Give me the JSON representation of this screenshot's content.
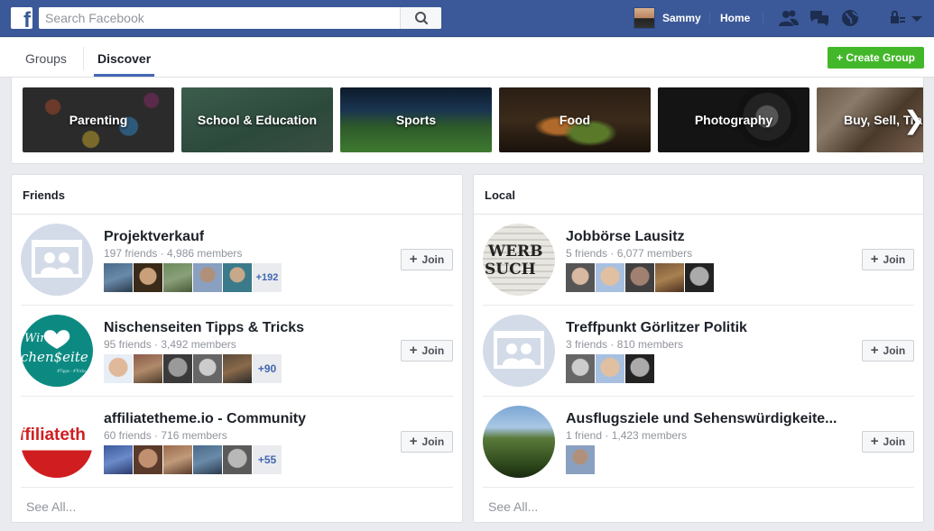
{
  "header": {
    "logo": "f",
    "search_placeholder": "Search Facebook",
    "user_name": "Sammy",
    "home_label": "Home",
    "accent": "#3b5998"
  },
  "tabs": [
    {
      "label": "Groups",
      "active": false
    },
    {
      "label": "Discover",
      "active": true
    }
  ],
  "create_group_label": "+ Create Group",
  "categories": [
    {
      "label": "Parenting"
    },
    {
      "label": "School & Education"
    },
    {
      "label": "Sports"
    },
    {
      "label": "Food"
    },
    {
      "label": "Photography"
    },
    {
      "label": "Buy, Sell, Tra"
    }
  ],
  "friends": {
    "title": "Friends",
    "groups": [
      {
        "name": "Projektverkauf",
        "meta": "197 friends · 4,986 members",
        "more": "+192"
      },
      {
        "name": "Nischenseiten Tipps & Tricks",
        "meta": "95 friends · 3,492 members",
        "more": "+90"
      },
      {
        "name": "affiliatetheme.io - Community",
        "meta": "60 friends · 716 members",
        "more": "+55"
      }
    ],
    "see_all": "See All..."
  },
  "local": {
    "title": "Local",
    "groups": [
      {
        "name": "Jobbörse Lausitz",
        "meta": "5 friends · 6,077 members"
      },
      {
        "name": "Treffpunkt Görlitzer Politik",
        "meta": "3 friends · 810 members"
      },
      {
        "name": "Ausflugsziele und Sehenswürdigkeite...",
        "meta": "1 friend · 1,423 members"
      }
    ],
    "see_all": "See All..."
  },
  "join_label": "Join",
  "group_image_text": {
    "nischen": "Wir ♥ Nischenseiten",
    "affiliate": "affiliatetheme",
    "jobs": "WERB SUCH"
  }
}
